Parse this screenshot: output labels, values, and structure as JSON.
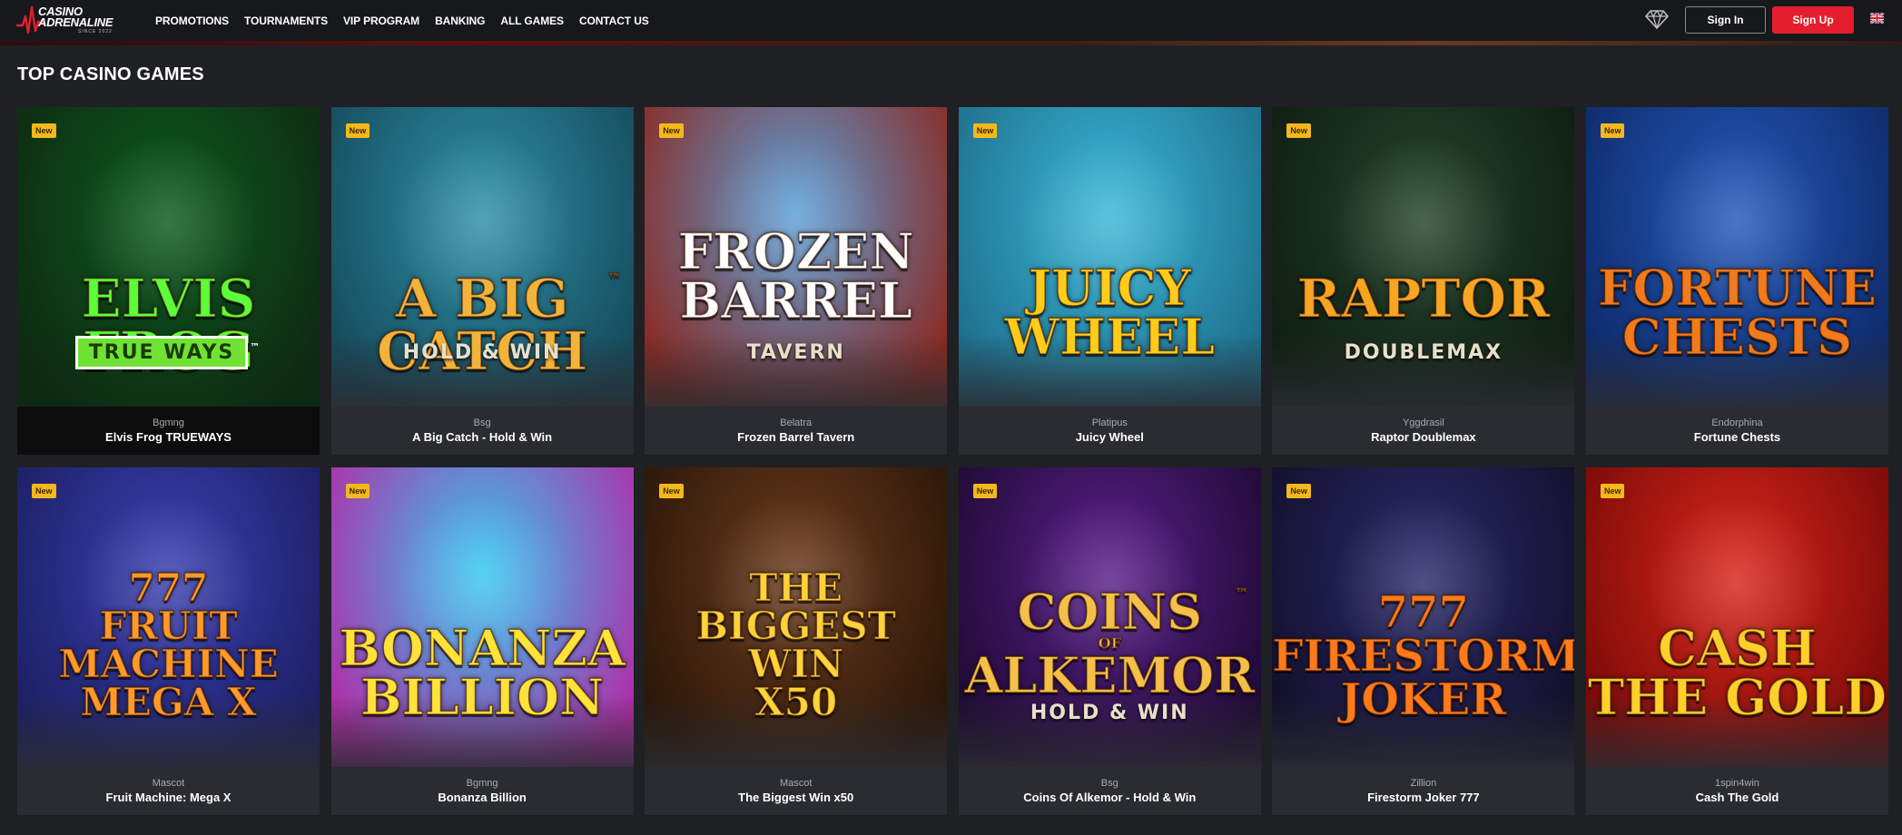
{
  "header": {
    "logo_line1": "CASINO",
    "logo_line2": "ADRENALINE",
    "logo_since": "SINCE 2022",
    "nav": [
      "PROMOTIONS",
      "TOURNAMENTS",
      "VIP PROGRAM",
      "BANKING",
      "ALL GAMES",
      "CONTACT US"
    ],
    "sign_in": "Sign In",
    "sign_up": "Sign Up",
    "icons": [
      "diamond-icon",
      "uk-flag-icon"
    ]
  },
  "section": {
    "title": "TOP CASINO GAMES"
  },
  "badge_label": "New",
  "games": [
    {
      "provider": "Bgmng",
      "name": "Elvis Frog TRUEWAYS",
      "art": [
        "ELVIS FROG"
      ],
      "art_sub": "TRUE WAYS",
      "art_sub_mark": "™",
      "bg": [
        "#0b5a1e",
        "#0f2a12"
      ],
      "title_color": "#5cff3a",
      "new": true,
      "active": true
    },
    {
      "provider": "Bsg",
      "name": "A Big Catch - Hold & Win",
      "art": [
        "A BIG CATCH"
      ],
      "art_sub": "HOLD & WIN",
      "art_mark": "™",
      "bg": [
        "#2f8fa6",
        "#154b5c"
      ],
      "title_color": "#f2b33a",
      "new": true
    },
    {
      "provider": "Belatra",
      "name": "Frozen Barrel Tavern",
      "art": [
        "FROZEN",
        "BARREL"
      ],
      "art_sub": "TAVERN",
      "bg": [
        "#5a9fd8",
        "#8a2a22"
      ],
      "title_color": "#ffffff",
      "new": true
    },
    {
      "provider": "Platipus",
      "name": "Juicy Wheel",
      "art": [
        "JUICY",
        "WHEEL"
      ],
      "bg": [
        "#3bb6d6",
        "#1d6f8c"
      ],
      "title_color": "#ffcc1a",
      "new": true
    },
    {
      "provider": "Yggdrasil",
      "name": "Raptor Doublemax",
      "art": [
        "RAPTOR"
      ],
      "art_sub": "DOUBLEMAX",
      "bg": [
        "#23432a",
        "#0f1d12"
      ],
      "title_color": "#f6a623",
      "new": true
    },
    {
      "provider": "Endorphina",
      "name": "Fortune Chests",
      "art": [
        "FORTUNE",
        "CHESTS"
      ],
      "bg": [
        "#2459b8",
        "#0e2a6a"
      ],
      "title_color": "#f07a1c",
      "new": true
    },
    {
      "provider": "Mascot",
      "name": "Fruit Machine: Mega X",
      "art": [
        "777",
        "FRUIT",
        "MACHINE",
        "MEGA X"
      ],
      "bg": [
        "#3a3fb0",
        "#1c1f63"
      ],
      "title_color": "#ff9a2a",
      "new": true
    },
    {
      "provider": "Bgmng",
      "name": "Bonanza Billion",
      "art": [
        "BONANZA",
        "BILLION"
      ],
      "bg": [
        "#34c9f0",
        "#b02ea8"
      ],
      "title_color": "#ffe23a",
      "new": true
    },
    {
      "provider": "Mascot",
      "name": "The Biggest Win x50",
      "art": [
        "THE",
        "BIGGEST",
        "WIN",
        "X50"
      ],
      "bg": [
        "#6a3b1c",
        "#2a1608"
      ],
      "title_color": "#ffd23a",
      "new": true
    },
    {
      "provider": "Bsg",
      "name": "Coins Of Alkemor - Hold & Win",
      "art": [
        "COINS",
        "ALKEMOR"
      ],
      "art_sub": "HOLD & WIN",
      "art_of": "OF",
      "art_mark": "™",
      "bg": [
        "#5a1f8a",
        "#1e0a33"
      ],
      "title_color": "#f4c04a",
      "new": true
    },
    {
      "provider": "Zillion",
      "name": "Firestorm Joker 777",
      "art": [
        "777",
        "FIRESTORM",
        "JOKER"
      ],
      "bg": [
        "#2a2a6a",
        "#120f2a"
      ],
      "title_color": "#ff7a1a",
      "new": true
    },
    {
      "provider": "1spin4win",
      "name": "Cash The Gold",
      "art": [
        "CASH",
        "THE GOLD"
      ],
      "bg": [
        "#d6251a",
        "#7a0a08"
      ],
      "title_color": "#ffcf2a",
      "new": true
    }
  ]
}
